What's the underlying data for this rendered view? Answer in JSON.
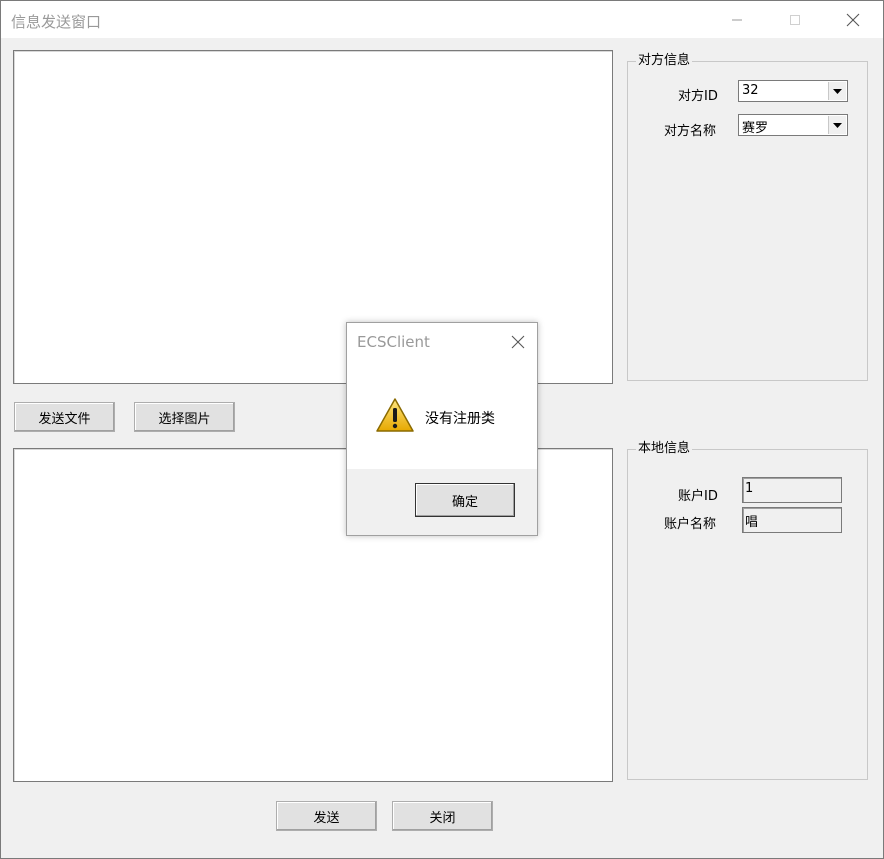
{
  "window": {
    "title": "信息发送窗口",
    "minimize_icon": "minimize-icon",
    "maximize_icon": "maximize-icon",
    "close_icon": "close-icon"
  },
  "toolbar": {
    "send_file_label": "发送文件",
    "select_image_label": "选择图片"
  },
  "bottom": {
    "send_label": "发送",
    "close_label": "关闭"
  },
  "peer_info": {
    "group_title": "对方信息",
    "id_label": "对方ID",
    "id_value": "32",
    "name_label": "对方名称",
    "name_value": "赛罗"
  },
  "local_info": {
    "group_title": "本地信息",
    "account_id_label": "账户ID",
    "account_id_value": "1",
    "account_name_label": "账户名称",
    "account_name_value": "唱"
  },
  "dialog": {
    "title": "ECSClient",
    "message": "没有注册类",
    "ok_label": "确定",
    "icon": "warning-icon"
  }
}
